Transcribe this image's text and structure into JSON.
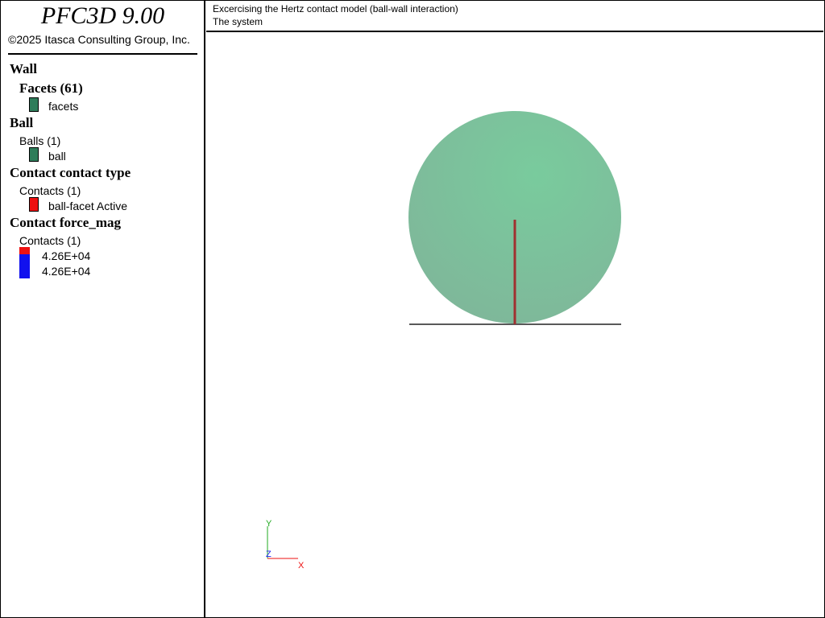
{
  "app": {
    "title": "PFC3D 9.00",
    "copyright": "©2025 Itasca Consulting Group, Inc."
  },
  "header": {
    "line1": "Excercising the Hertz contact model (ball-wall interaction)",
    "line2": "The system"
  },
  "legend": {
    "wall": {
      "heading": "Wall",
      "facets_heading": "Facets (61)",
      "facets_label": "facets",
      "facets_color": "#2e7d5a"
    },
    "ball": {
      "heading": "Ball",
      "balls_heading": "Balls (1)",
      "ball_label": "ball",
      "ball_color": "#2e7d5a"
    },
    "contact_type": {
      "heading": "Contact contact type",
      "contacts_heading": "Contacts (1)",
      "item_label": "ball-facet Active",
      "item_color": "#ee1111"
    },
    "contact_force": {
      "heading": "Contact force_mag",
      "contacts_heading": "Contacts (1)",
      "max_label": "4.26E+04",
      "min_label": "4.26E+04",
      "max_color": "#ee1111",
      "min_color": "#1111ee"
    }
  },
  "axes": {
    "x_label": "X",
    "y_label": "Y",
    "z_label": "Z",
    "x_color": "#ee1111",
    "y_color": "#22aa22",
    "z_color": "#2222ee"
  },
  "scene": {
    "ball_color": "#7fb79a",
    "ball_highlight": "#79cb9d",
    "force_chain_color": "#a03030",
    "wall_color": "#222222"
  }
}
